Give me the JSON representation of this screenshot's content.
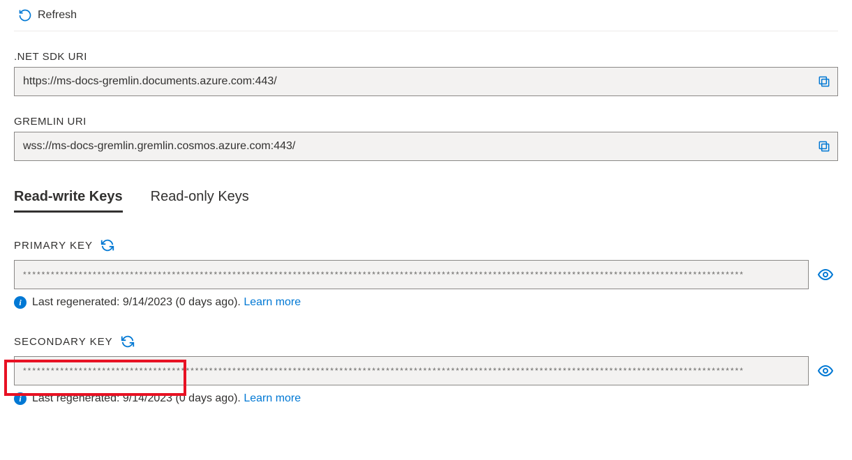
{
  "toolbar": {
    "refresh_label": "Refresh"
  },
  "uris": {
    "net_sdk_label": ".NET SDK URI",
    "net_sdk_value": "https://ms-docs-gremlin.documents.azure.com:443/",
    "gremlin_label": "GREMLIN URI",
    "gremlin_value": "wss://ms-docs-gremlin.gremlin.cosmos.azure.com:443/"
  },
  "tabs": {
    "readwrite": "Read-write Keys",
    "readonly": "Read-only Keys"
  },
  "keys": {
    "primary_label": "PRIMARY KEY",
    "primary_value": "***********************************************************************************************************************************************************",
    "primary_info_prefix": "Last regenerated: 9/14/2023 (0 days ago). ",
    "primary_learn_more": "Learn more",
    "secondary_label": "SECONDARY KEY",
    "secondary_value": "***********************************************************************************************************************************************************",
    "secondary_info_prefix": "Last regenerated: 9/14/2023 (0 days ago). ",
    "secondary_learn_more": "Learn more"
  }
}
